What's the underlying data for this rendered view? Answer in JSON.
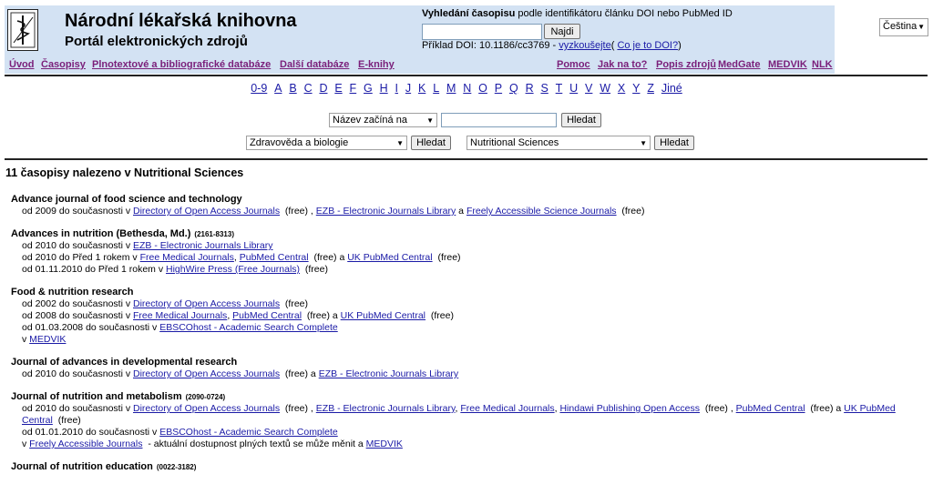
{
  "header": {
    "title": "Národní lékařská knihovna",
    "subtitle": "Portál elektronických zdrojů",
    "search_label_bold": "Vyhledání časopisu",
    "search_label_rest": " podle identifikátoru článku DOI nebo PubMed ID",
    "find_button": "Najdi",
    "doi_example_prefix": "Příklad DOI: 10.1186/cc3769 - ",
    "try_link": "vyzkoušejte",
    "paren_open": "( ",
    "what_doi_link": "Co je to DOI?",
    "paren_close": ")",
    "language": "Čeština"
  },
  "nav": {
    "left": [
      "Úvod",
      "Časopisy",
      "Plnotextové a bibliografické databáze",
      "Další databáze",
      "E-knihy"
    ],
    "right": [
      "Pomoc",
      "Jak na to?",
      "Popis zdrojů",
      "MedGate",
      "MEDVIK",
      "NLK"
    ]
  },
  "alphabet": [
    "0-9",
    "A",
    "B",
    "C",
    "D",
    "E",
    "F",
    "G",
    "H",
    "I",
    "J",
    "K",
    "L",
    "M",
    "N",
    "O",
    "P",
    "Q",
    "R",
    "S",
    "T",
    "U",
    "V",
    "W",
    "X",
    "Y",
    "Z",
    "Jiné"
  ],
  "filters": {
    "name_select": "Název začíná na",
    "search_button": "Hledat",
    "category_select": "Zdravověda a biologie",
    "subcategory_select": "Nutritional Sciences"
  },
  "results_heading": "11 časopisy nalezeno v Nutritional Sciences",
  "journals": [
    {
      "title": "Advance journal of food science and technology",
      "issn": "",
      "lines": [
        [
          {
            "t": "od 2009 do současnosti v "
          },
          {
            "l": "Directory of Open Access Journals"
          },
          {
            "t": "  (free) , "
          },
          {
            "l": "EZB - Electronic Journals Library"
          },
          {
            "t": " a "
          },
          {
            "l": "Freely Accessible Science Journals"
          },
          {
            "t": "  (free)"
          }
        ]
      ]
    },
    {
      "title": "Advances in nutrition (Bethesda, Md.)",
      "issn": "(2161-8313)",
      "lines": [
        [
          {
            "t": "od 2010 do současnosti v "
          },
          {
            "l": "EZB - Electronic Journals Library"
          }
        ],
        [
          {
            "t": "od 2010 do Před 1 rokem v "
          },
          {
            "l": "Free Medical Journals"
          },
          {
            "t": ", "
          },
          {
            "l": "PubMed Central"
          },
          {
            "t": "  (free) a "
          },
          {
            "l": "UK PubMed Central"
          },
          {
            "t": "  (free)"
          }
        ],
        [
          {
            "t": "od 01.11.2010 do Před 1 rokem v "
          },
          {
            "l": "HighWire Press (Free Journals)"
          },
          {
            "t": "  (free)"
          }
        ]
      ]
    },
    {
      "title": "Food & nutrition research",
      "issn": "",
      "lines": [
        [
          {
            "t": "od 2002 do současnosti v "
          },
          {
            "l": "Directory of Open Access Journals"
          },
          {
            "t": "  (free)"
          }
        ],
        [
          {
            "t": "od 2008 do současnosti v "
          },
          {
            "l": "Free Medical Journals"
          },
          {
            "t": ", "
          },
          {
            "l": "PubMed Central"
          },
          {
            "t": "  (free) a "
          },
          {
            "l": "UK PubMed Central"
          },
          {
            "t": "  (free)"
          }
        ],
        [
          {
            "t": "od 01.03.2008 do současnosti v "
          },
          {
            "l": "EBSCOhost - Academic Search Complete"
          }
        ],
        [
          {
            "t": "v "
          },
          {
            "l": "MEDVIK"
          }
        ]
      ]
    },
    {
      "title": "Journal of advances in developmental research",
      "issn": "",
      "lines": [
        [
          {
            "t": "od 2010 do současnosti v "
          },
          {
            "l": "Directory of Open Access Journals"
          },
          {
            "t": "  (free) a "
          },
          {
            "l": "EZB - Electronic Journals Library"
          }
        ]
      ]
    },
    {
      "title": "Journal of nutrition and metabolism",
      "issn": "(2090-0724)",
      "lines": [
        [
          {
            "t": "od 2010 do současnosti v "
          },
          {
            "l": "Directory of Open Access Journals"
          },
          {
            "t": "  (free) , "
          },
          {
            "l": "EZB - Electronic Journals Library"
          },
          {
            "t": ", "
          },
          {
            "l": "Free Medical Journals"
          },
          {
            "t": ", "
          },
          {
            "l": "Hindawi Publishing Open Access"
          },
          {
            "t": "  (free) , "
          },
          {
            "l": "PubMed Central"
          },
          {
            "t": "  (free) a "
          },
          {
            "l": "UK PubMed Central"
          },
          {
            "t": "  (free)"
          }
        ],
        [
          {
            "t": "od 01.01.2010 do současnosti v "
          },
          {
            "l": "EBSCOhost - Academic Search Complete"
          }
        ],
        [
          {
            "t": "v "
          },
          {
            "l": "Freely Accessible Journals"
          },
          {
            "t": "  - aktuální dostupnost plných textů se může měnit a "
          },
          {
            "l": "MEDVIK"
          }
        ]
      ]
    },
    {
      "title": "Journal of nutrition education",
      "issn": "(0022-3182)",
      "lines": []
    }
  ]
}
